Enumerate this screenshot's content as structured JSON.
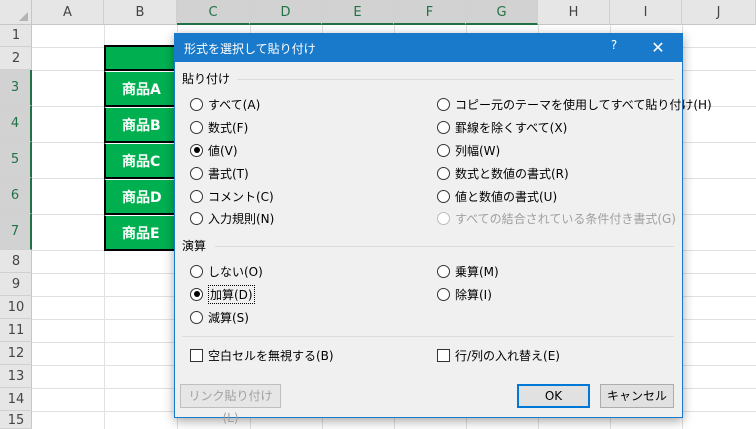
{
  "sheet": {
    "columns": [
      "A",
      "B",
      "C",
      "D",
      "E",
      "F",
      "G",
      "H",
      "I",
      "J"
    ],
    "rows": [
      "1",
      "2",
      "3",
      "4",
      "5",
      "6",
      "7",
      "8",
      "9",
      "10",
      "11",
      "12",
      "13",
      "14",
      "15"
    ],
    "products": [
      "商品A",
      "商品B",
      "商品C",
      "商品D",
      "商品E"
    ],
    "table_fill_color": "#00b050",
    "selection_color": "#217346"
  },
  "dialog": {
    "title": "形式を選択して貼り付け",
    "help_label": "?",
    "close_label": "✕",
    "paste_group_label": "貼り付け",
    "paste_options_left": [
      "すべて(A)",
      "数式(F)",
      "値(V)",
      "書式(T)",
      "コメント(C)",
      "入力規則(N)"
    ],
    "paste_options_right": [
      "コピー元のテーマを使用してすべて貼り付け(H)",
      "罫線を除くすべて(X)",
      "列幅(W)",
      "数式と数値の書式(R)",
      "値と数値の書式(U)",
      "すべての結合されている条件付き書式(G)"
    ],
    "paste_selected": "値(V)",
    "operation_group_label": "演算",
    "operation_options_left": [
      "しない(O)",
      "加算(D)",
      "減算(S)"
    ],
    "operation_options_right": [
      "乗算(M)",
      "除算(I)"
    ],
    "operation_selected": "加算(D)",
    "skip_blanks_label": "空白セルを無視する(B)",
    "skip_blanks_checked": false,
    "transpose_label": "行/列の入れ替え(E)",
    "transpose_checked": false,
    "paste_link_label": "リンク貼り付け(L)",
    "ok_label": "OK",
    "cancel_label": "キャンセル",
    "titlebar_color": "#1979ca"
  }
}
